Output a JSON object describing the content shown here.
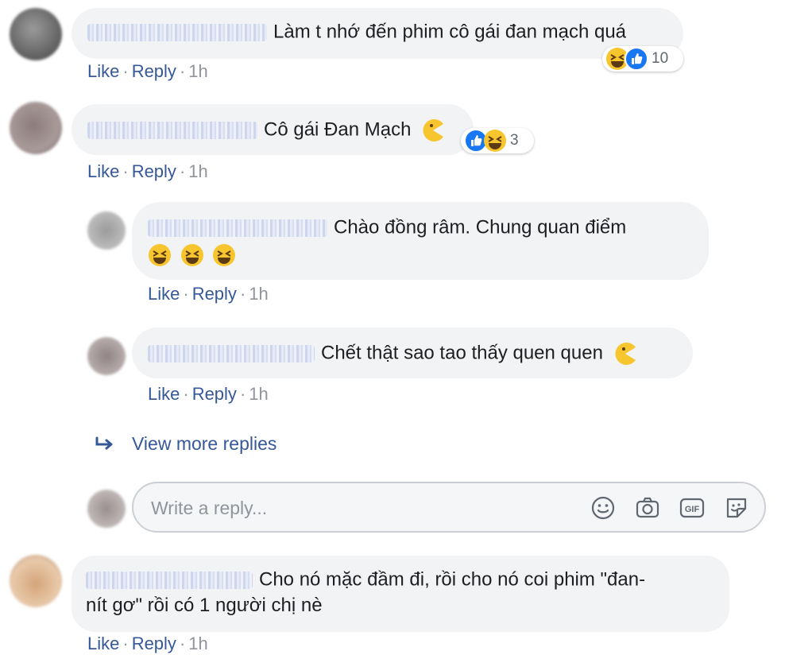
{
  "comments": [
    {
      "text": "Làm t nhớ đến phim cô gái đan mạch quá",
      "reaction_count": "10"
    },
    {
      "text": "Cô gái Đan Mạch",
      "reaction_count": "3"
    },
    {
      "text_line1": "Chào đồng râm. Chung quan điểm"
    },
    {
      "text": "Chết thật sao tao thấy quen quen"
    },
    {
      "text_line1": "Cho nó mặc đầm đi, rồi cho nó coi phim \"đan-",
      "text_line2": "nít gơ\" rồi có 1 người chị nè"
    }
  ],
  "actions": {
    "like": "Like",
    "reply": "Reply",
    "sep": "·",
    "time": "1h"
  },
  "view_more": "View more replies",
  "reply_box": {
    "placeholder": "Write a reply...",
    "icons": [
      "smile-icon",
      "camera-icon",
      "gif-icon",
      "sticker-icon"
    ]
  },
  "colors": {
    "link": "#365899",
    "bubble": "#f2f3f5",
    "like_blue": "#1877f2",
    "emoji_yellow": "#f7c52d"
  }
}
